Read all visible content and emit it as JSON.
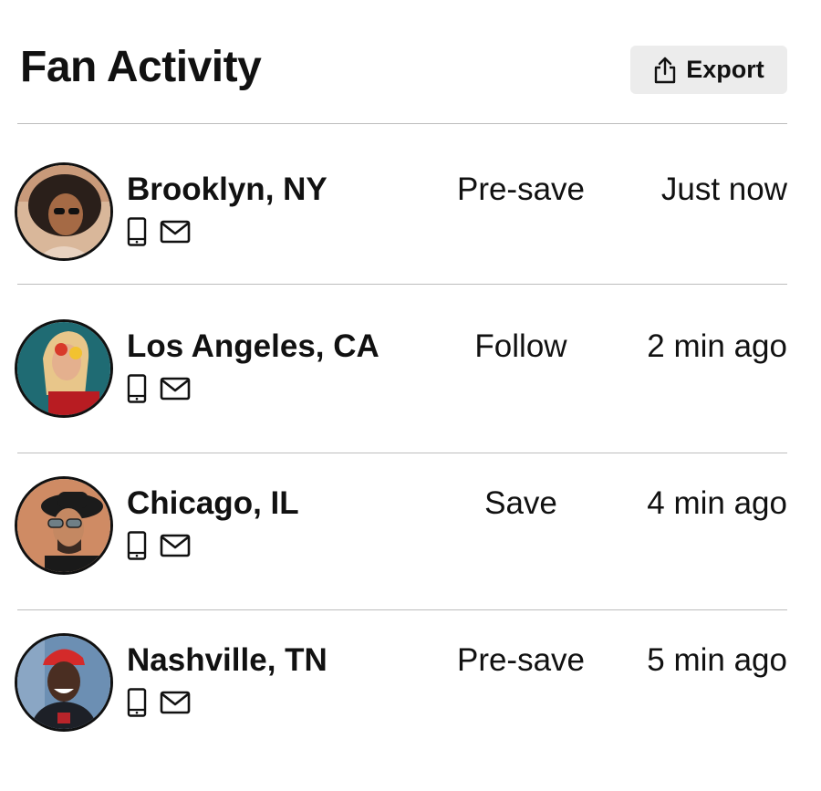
{
  "header": {
    "title": "Fan Activity",
    "export_label": "Export",
    "export_icon": "share-export-icon"
  },
  "colors": {
    "text": "#111111",
    "divider": "#bdbdbd",
    "button_bg": "#ececec"
  },
  "rows": [
    {
      "city": "Brooklyn, NY",
      "action": "Pre-save",
      "time": "Just now",
      "icons": [
        "phone-icon",
        "mail-icon"
      ],
      "avatar": "avatar-photo"
    },
    {
      "city": "Los Angeles, CA",
      "action": "Follow",
      "time": "2 min ago",
      "icons": [
        "phone-icon",
        "mail-icon"
      ],
      "avatar": "avatar-photo"
    },
    {
      "city": "Chicago, IL",
      "action": "Save",
      "time": "4 min ago",
      "icons": [
        "phone-icon",
        "mail-icon"
      ],
      "avatar": "avatar-photo"
    },
    {
      "city": "Nashville, TN",
      "action": "Pre-save",
      "time": "5 min ago",
      "icons": [
        "phone-icon",
        "mail-icon"
      ],
      "avatar": "avatar-photo"
    }
  ]
}
